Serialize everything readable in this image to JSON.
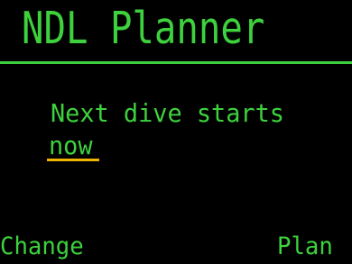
{
  "screen": {
    "title": "NDL Planner"
  },
  "main": {
    "message": "Next dive starts",
    "start_value": "now"
  },
  "softkeys": {
    "left_label": "Change",
    "right_label": "Plan"
  },
  "colors": {
    "text": "#3ed13e",
    "background": "#000000",
    "cursor": "#f0b400"
  }
}
